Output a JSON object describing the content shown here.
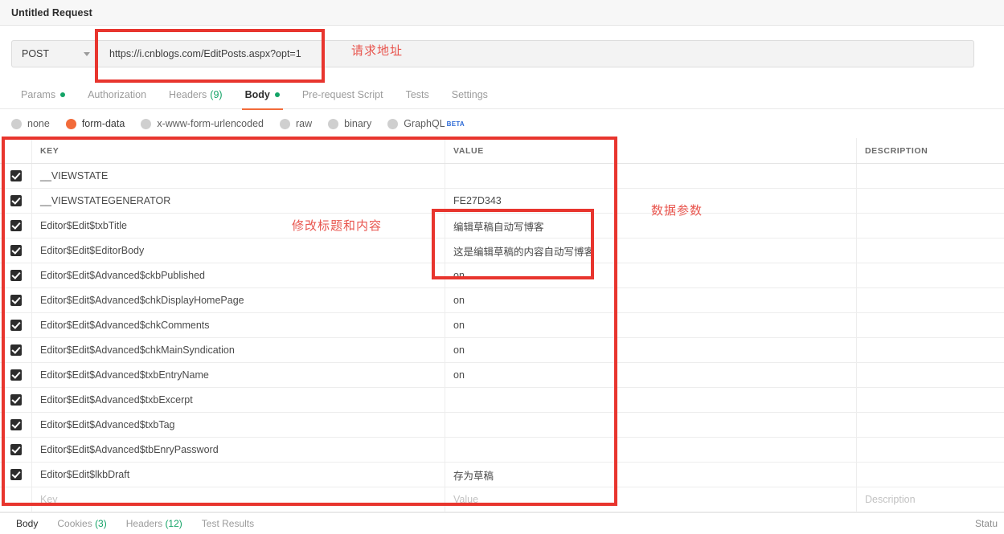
{
  "window": {
    "request_title": "Untitled Request"
  },
  "request": {
    "method": "POST",
    "url": "https://i.cnblogs.com/EditPosts.aspx?opt=1"
  },
  "tabs": [
    {
      "label": "Params",
      "badge": "dot",
      "active": false
    },
    {
      "label": "Authorization",
      "badge": "",
      "active": false
    },
    {
      "label": "Headers",
      "count": "(9)",
      "badge": "count",
      "active": false
    },
    {
      "label": "Body",
      "badge": "dot",
      "active": true
    },
    {
      "label": "Pre-request Script",
      "badge": "",
      "active": false
    },
    {
      "label": "Tests",
      "badge": "",
      "active": false
    },
    {
      "label": "Settings",
      "badge": "",
      "active": false
    }
  ],
  "body_types": [
    {
      "label": "none",
      "selected": false
    },
    {
      "label": "form-data",
      "selected": true
    },
    {
      "label": "x-www-form-urlencoded",
      "selected": false
    },
    {
      "label": "raw",
      "selected": false
    },
    {
      "label": "binary",
      "selected": false
    },
    {
      "label": "GraphQL",
      "selected": false,
      "beta": "BETA"
    }
  ],
  "table": {
    "headers": {
      "key": "KEY",
      "value": "VALUE",
      "description": "DESCRIPTION"
    },
    "rows": [
      {
        "checked": true,
        "key": "__VIEWSTATE",
        "value": "",
        "description": ""
      },
      {
        "checked": true,
        "key": "__VIEWSTATEGENERATOR",
        "value": "FE27D343",
        "description": ""
      },
      {
        "checked": true,
        "key": "Editor$Edit$txbTitle",
        "value": "编辑草稿自动写博客",
        "description": ""
      },
      {
        "checked": true,
        "key": "Editor$Edit$EditorBody",
        "value": "这是编辑草稿的内容自动写博客",
        "description": ""
      },
      {
        "checked": true,
        "key": "Editor$Edit$Advanced$ckbPublished",
        "value": "on",
        "description": ""
      },
      {
        "checked": true,
        "key": "Editor$Edit$Advanced$chkDisplayHomePage",
        "value": "on",
        "description": ""
      },
      {
        "checked": true,
        "key": "Editor$Edit$Advanced$chkComments",
        "value": "on",
        "description": ""
      },
      {
        "checked": true,
        "key": "Editor$Edit$Advanced$chkMainSyndication",
        "value": "on",
        "description": ""
      },
      {
        "checked": true,
        "key": "Editor$Edit$Advanced$txbEntryName",
        "value": "on",
        "description": ""
      },
      {
        "checked": true,
        "key": "Editor$Edit$Advanced$txbExcerpt",
        "value": "",
        "description": ""
      },
      {
        "checked": true,
        "key": "Editor$Edit$Advanced$txbTag",
        "value": "",
        "description": ""
      },
      {
        "checked": true,
        "key": "Editor$Edit$Advanced$tbEnryPassword",
        "value": "",
        "description": ""
      },
      {
        "checked": true,
        "key": "Editor$Edit$lkbDraft",
        "value": "存为草稿",
        "description": ""
      }
    ],
    "new_row": {
      "key_placeholder": "Key",
      "value_placeholder": "Value",
      "description_placeholder": "Description"
    }
  },
  "response_bar": {
    "tabs": [
      {
        "label": "Body",
        "count": "",
        "active": true
      },
      {
        "label": "Cookies",
        "count": "(3)",
        "active": false
      },
      {
        "label": "Headers",
        "count": "(12)",
        "active": false
      },
      {
        "label": "Test Results",
        "count": "",
        "active": false
      }
    ],
    "status": "Statu"
  },
  "annotations": [
    {
      "id": "url",
      "text": "请求地址"
    },
    {
      "id": "edit",
      "text": "修改标题和内容"
    },
    {
      "id": "data",
      "text": "数据参数"
    }
  ],
  "colors": {
    "accent": "#f26b3a",
    "green_dot": "#13a366",
    "annotation_red": "#e8352e",
    "annotation_text": "#e8554e",
    "beta_blue": "#2d6ad6"
  }
}
